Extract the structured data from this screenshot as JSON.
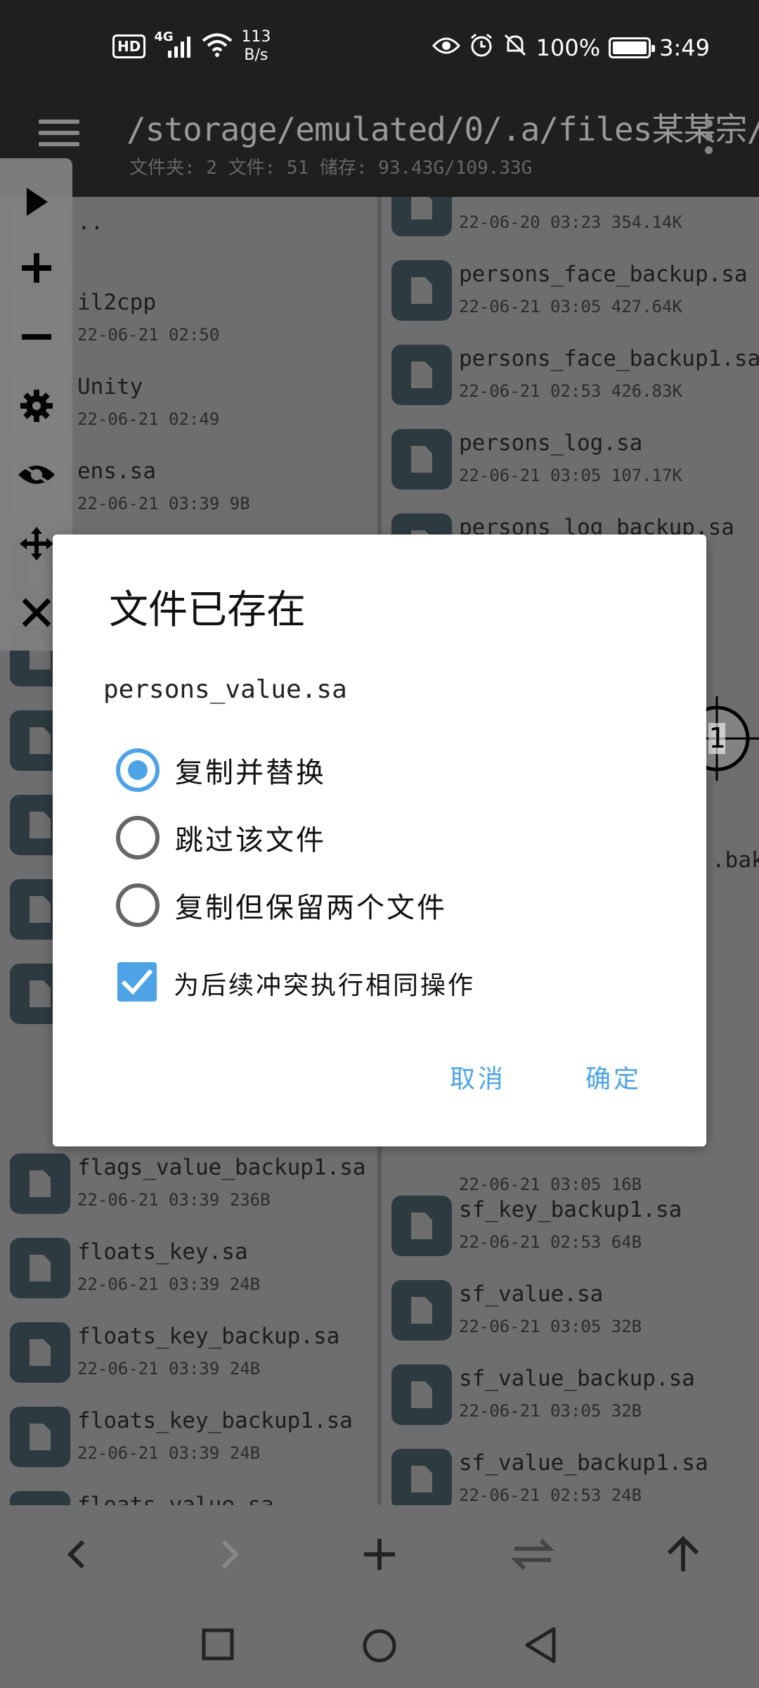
{
  "status_bar": {
    "hd": "HD",
    "signal": "4G",
    "net_speed_value": "113",
    "net_speed_unit": "B/s",
    "battery": "100%",
    "time": "3:49"
  },
  "titlebar": {
    "path": "/storage/emulated/0/.a/files某某宗/",
    "stats": "文件夹: 2  文件: 51  储存: 93.43G/109.33G"
  },
  "left_pane": [
    {
      "name": "..",
      "meta": ""
    },
    {
      "name": "il2cpp",
      "meta": "22-06-21 02:50"
    },
    {
      "name": "Unity",
      "meta": "22-06-21 02:49"
    },
    {
      "name": "ens.sa",
      "meta": "22-06-21 03:39 9B"
    },
    {
      "name": "flags_value_backup1.sa",
      "meta": "22-06-21 03:39 236B"
    },
    {
      "name": "floats_key.sa",
      "meta": "22-06-21 03:39 24B"
    },
    {
      "name": "floats_key_backup.sa",
      "meta": "22-06-21 03:39 24B"
    },
    {
      "name": "floats_key_backup1.sa",
      "meta": "22-06-21 03:39 24B"
    },
    {
      "name": "floats_value.sa",
      "meta": ""
    }
  ],
  "right_pane": [
    {
      "name": "",
      "meta": "22-06-20 03:23 354.14K"
    },
    {
      "name": "persons_face_backup.sa",
      "meta": "22-06-21 03:05 427.64K"
    },
    {
      "name": "persons_face_backup1.sa",
      "meta": "22-06-21 02:53 426.83K"
    },
    {
      "name": "persons_log.sa",
      "meta": "22-06-21 03:05 107.17K"
    },
    {
      "name": "persons_log_backup.sa",
      "meta": ""
    },
    {
      "name": "",
      "meta": "22-06-21 03:05 16B"
    },
    {
      "name": "sf_key_backup1.sa",
      "meta": "22-06-21 02:53 64B"
    },
    {
      "name": "sf_value.sa",
      "meta": "22-06-21 03:05 32B"
    },
    {
      "name": "sf_value_backup.sa",
      "meta": "22-06-21 03:05 32B"
    },
    {
      "name": "sf_value_backup1.sa",
      "meta": "22-06-21 02:53 24B"
    }
  ],
  "right_pane_partial": ".bak",
  "dialog": {
    "title": "文件已存在",
    "filename": "persons_value.sa",
    "options": [
      "复制并替换",
      "跳过该文件",
      "复制但保留两个文件"
    ],
    "selected_option": 0,
    "checkbox_label": "为后续冲突执行相同操作",
    "checkbox_checked": true,
    "cancel": "取消",
    "ok": "确定"
  },
  "crosshair_label": "1",
  "colors": {
    "accent": "#4da3e6",
    "icon_bg": "#2d3a3f",
    "pane_bg": "#6e6e6e",
    "titlebar_bg": "#1f1f1f"
  }
}
